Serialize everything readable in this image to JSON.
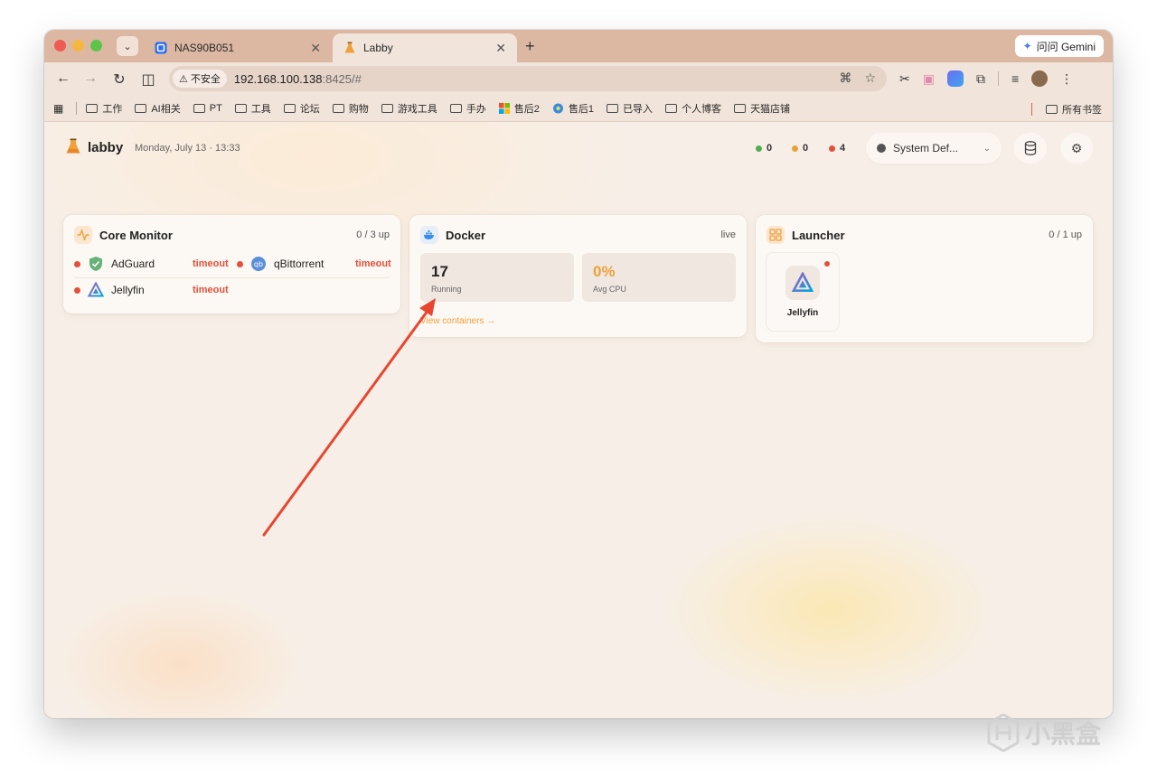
{
  "browser": {
    "tabs": [
      {
        "title": "NAS90B051",
        "active": false
      },
      {
        "title": "Labby",
        "active": true
      }
    ],
    "gemini_label": "问问 Gemini",
    "omnibox": {
      "insecure_label": "不安全",
      "host": "192.168.100.138",
      "rest": ":8425/#"
    },
    "bookmarks": [
      "工作",
      "AI相关",
      "PT",
      "工具",
      "论坛",
      "购物",
      "游戏工具",
      "手办",
      "售后2",
      "售后1",
      "已导入",
      "个人博客",
      "天猫店铺"
    ],
    "all_bookmarks_label": "所有书签"
  },
  "header": {
    "brand": "labby",
    "date": "Monday, July 13 · 13:33",
    "status_counts": [
      {
        "color": "#4caf50",
        "value": "0"
      },
      {
        "color": "#e6a23c",
        "value": "0"
      },
      {
        "color": "#e4503a",
        "value": "4"
      }
    ],
    "theme_label": "System Def..."
  },
  "core_monitor": {
    "title": "Core Monitor",
    "meta": "0 / 3 up",
    "services": [
      {
        "name": "AdGuard",
        "status": "timeout"
      },
      {
        "name": "qBittorrent",
        "status": "timeout"
      },
      {
        "name": "Jellyfin",
        "status": "timeout"
      }
    ]
  },
  "docker": {
    "title": "Docker",
    "meta": "live",
    "running_value": "17",
    "running_label": "Running",
    "cpu_value": "0%",
    "cpu_label": "Avg CPU",
    "link": "View containers →"
  },
  "launcher": {
    "title": "Launcher",
    "meta": "0 / 1 up",
    "apps": [
      {
        "name": "Jellyfin"
      }
    ]
  },
  "watermark": "小黑盒",
  "colors": {
    "accent": "#f0a03a",
    "error": "#e4503a",
    "ok": "#4caf50",
    "warn": "#e6a23c",
    "arrow": "#e8462e"
  }
}
